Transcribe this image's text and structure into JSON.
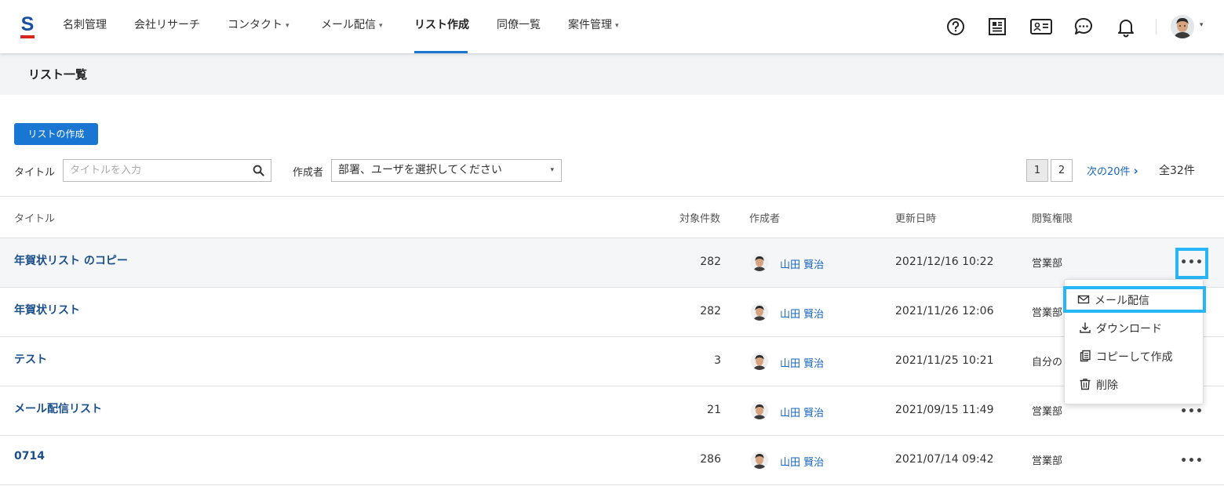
{
  "nav": {
    "logo_letter": "S",
    "items": [
      {
        "label": "名刺管理",
        "dropdown": false
      },
      {
        "label": "会社リサーチ",
        "dropdown": false
      },
      {
        "label": "コンタクト",
        "dropdown": true
      },
      {
        "label": "メール配信",
        "dropdown": true
      },
      {
        "label": "リスト作成",
        "dropdown": false,
        "active": true
      },
      {
        "label": "同僚一覧",
        "dropdown": false
      },
      {
        "label": "案件管理",
        "dropdown": true
      }
    ],
    "caret": "▾",
    "icons": [
      "help-icon",
      "card-list-icon",
      "contact-card-icon",
      "chat-icon",
      "bell-icon",
      "user-avatar"
    ]
  },
  "page": {
    "title": "リスト一覧",
    "create_button": "リストの作成"
  },
  "filters": {
    "title_label": "タイトル",
    "title_placeholder": "タイトルを入力",
    "creator_label": "作成者",
    "creator_select": "部署、ユーザを選択してください"
  },
  "pagination": {
    "pages": [
      "1",
      "2"
    ],
    "current": "1",
    "next_label": "次の20件",
    "next_chevron": "›",
    "total": "全32件"
  },
  "table": {
    "headers": {
      "title": "タイトル",
      "count": "対象件数",
      "creator": "作成者",
      "updated": "更新日時",
      "permission": "閲覧権限"
    },
    "more_label": "•••",
    "rows": [
      {
        "title": "年賀状リスト のコピー",
        "count": "282",
        "creator": "山田 賢治",
        "updated": "2021/12/16 10:22",
        "permission": "営業部"
      },
      {
        "title": "年賀状リスト",
        "count": "282",
        "creator": "山田 賢治",
        "updated": "2021/11/26 12:06",
        "permission": "営業部"
      },
      {
        "title": "テスト",
        "count": "3",
        "creator": "山田 賢治",
        "updated": "2021/11/25 10:21",
        "permission": "自分の"
      },
      {
        "title": "メール配信リスト",
        "count": "21",
        "creator": "山田 賢治",
        "updated": "2021/09/15 11:49",
        "permission": "営業部"
      },
      {
        "title": "0714",
        "count": "286",
        "creator": "山田 賢治",
        "updated": "2021/07/14 09:42",
        "permission": "営業部"
      }
    ]
  },
  "menu": {
    "items": [
      {
        "label": "メール配信",
        "icon": "mail-icon"
      },
      {
        "label": "ダウンロード",
        "icon": "download-icon"
      },
      {
        "label": "コピーして作成",
        "icon": "copy-icon"
      },
      {
        "label": "削除",
        "icon": "trash-icon"
      }
    ]
  },
  "colors": {
    "accent": "#1976d2",
    "focus_outline": "#29b6f6",
    "link": "#1565c0",
    "logo_red": "#d9251c"
  }
}
